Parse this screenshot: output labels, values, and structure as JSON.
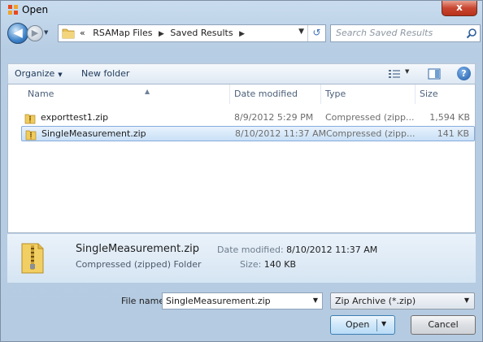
{
  "window": {
    "title": "Open",
    "close_glyph": "x"
  },
  "address": {
    "prefix": "«",
    "crumbs": [
      "RSAMap Files",
      "Saved Results"
    ],
    "search_placeholder": "Search Saved Results"
  },
  "toolbar": {
    "organize_label": "Organize",
    "new_folder_label": "New folder",
    "help_glyph": "?"
  },
  "columns": {
    "name": "Name",
    "date": "Date modified",
    "type": "Type",
    "size": "Size"
  },
  "files": [
    {
      "name": "exporttest1.zip",
      "date": "8/9/2012 5:29 PM",
      "type": "Compressed (zipp...",
      "size": "1,594 KB",
      "selected": false
    },
    {
      "name": "SingleMeasurement.zip",
      "date": "8/10/2012 11:37 AM",
      "type": "Compressed (zipp...",
      "size": "141 KB",
      "selected": true
    }
  ],
  "details": {
    "name": "SingleMeasurement.zip",
    "subtype": "Compressed (zipped) Folder",
    "date_key": "Date modified:",
    "date_value": "8/10/2012 11:37 AM",
    "size_key": "Size:",
    "size_value": "140 KB"
  },
  "bottom": {
    "file_name_label": "File name:",
    "file_name_value": "SingleMeasurement.zip",
    "file_type_value": "Zip Archive (*.zip)",
    "open_label": "Open",
    "cancel_label": "Cancel"
  },
  "icons": {
    "app": "dialog-app-icon",
    "back": "back-arrow-icon",
    "forward": "forward-arrow-icon",
    "folder": "folder-icon",
    "refresh": "refresh-icon",
    "search": "search-icon",
    "zip": "zip-folder-icon",
    "help": "help-icon"
  },
  "colors": {
    "selection": "#c9e0f7",
    "accent": "#3c7fb1",
    "close": "#c8452f"
  }
}
